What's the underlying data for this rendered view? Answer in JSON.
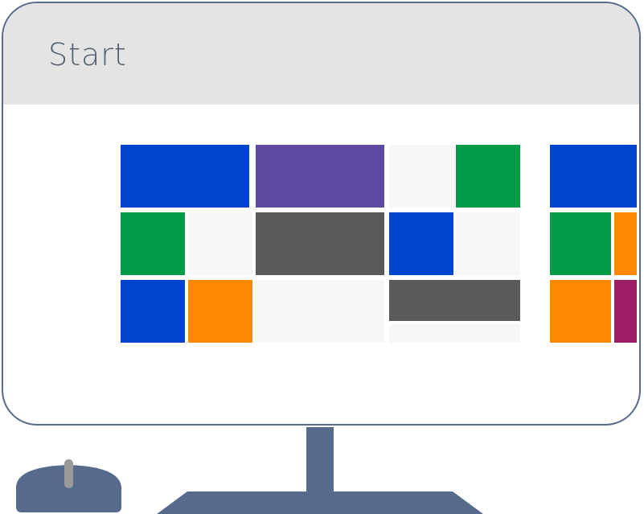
{
  "screen": {
    "title": "Start"
  },
  "colors": {
    "blue": "#0045cc",
    "purple": "#5e4a9e",
    "green": "#009b47",
    "gray": "#595a5c",
    "orange": "#ff8800",
    "magenta": "#9b1d63",
    "empty": "#f8f6f7",
    "frame": "#566a8b",
    "header": "#e4e4e4"
  },
  "tiles": [
    {
      "name": "tile-blue-wide",
      "color": "blue"
    },
    {
      "name": "tile-purple-wide",
      "color": "purple"
    },
    {
      "name": "tile-empty",
      "color": "empty"
    },
    {
      "name": "tile-green",
      "color": "green"
    },
    {
      "name": "tile-green",
      "color": "green"
    },
    {
      "name": "tile-empty",
      "color": "empty"
    },
    {
      "name": "tile-gray-wide",
      "color": "gray"
    },
    {
      "name": "tile-blue",
      "color": "blue"
    },
    {
      "name": "tile-empty",
      "color": "empty"
    },
    {
      "name": "tile-blue",
      "color": "blue"
    },
    {
      "name": "tile-orange",
      "color": "orange"
    },
    {
      "name": "tile-empty-wide",
      "color": "empty"
    },
    {
      "name": "tile-gray-wide",
      "color": "gray"
    },
    {
      "name": "tile-empty-strip",
      "color": "empty"
    },
    {
      "name": "tile-blue-wide",
      "color": "blue"
    },
    {
      "name": "tile-green",
      "color": "green"
    },
    {
      "name": "tile-orange",
      "color": "orange"
    },
    {
      "name": "tile-orange",
      "color": "orange"
    },
    {
      "name": "tile-magenta",
      "color": "magenta"
    }
  ]
}
